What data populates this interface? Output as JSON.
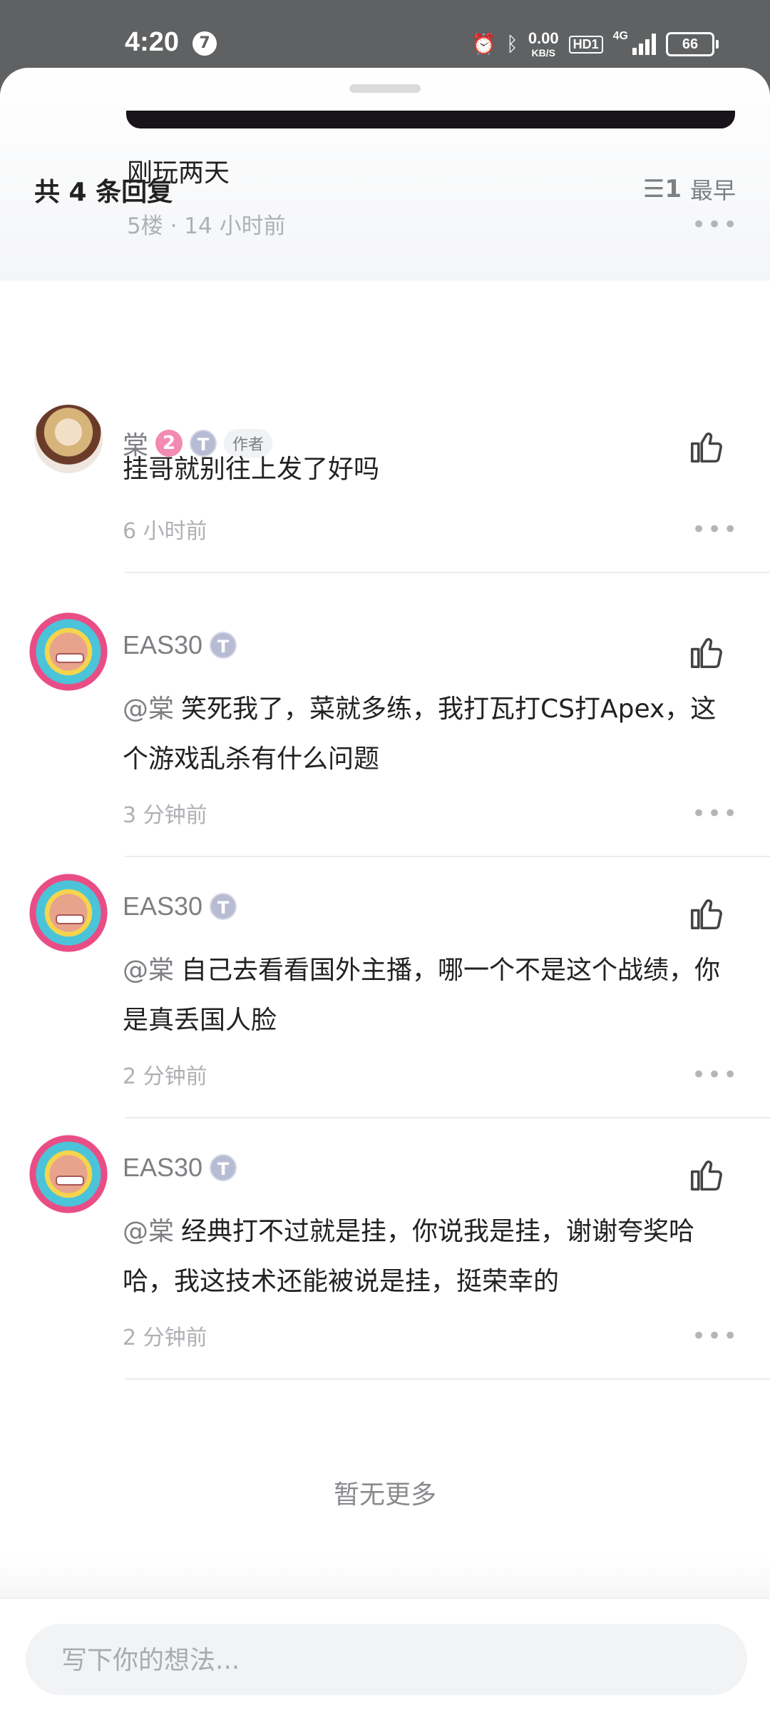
{
  "status_bar": {
    "time": "4:20",
    "app_icon": "7",
    "net_speed": "0.00",
    "net_unit": "KB/S",
    "hd": "HD1",
    "network": "4G",
    "battery": "66"
  },
  "parent": {
    "text": "刚玩两天",
    "meta": "5楼 · 14 小时前"
  },
  "replies_header": {
    "title": "共 4 条回复",
    "sort_label": "最早"
  },
  "comments": [
    {
      "name": "棠",
      "level": "2",
      "badge": "T",
      "tag": "作者",
      "text": "挂哥就别往上发了好吗",
      "time": "6 小时前"
    },
    {
      "name": "EAS30",
      "badge": "T",
      "mention": "@棠",
      "text": "笑死我了，菜就多练，我打瓦打CS打Apex，这个游戏乱杀有什么问题",
      "time": "3 分钟前"
    },
    {
      "name": "EAS30",
      "badge": "T",
      "mention": "@棠",
      "text": "自己去看看国外主播，哪一个不是这个战绩，你是真丢国人脸",
      "time": "2 分钟前"
    },
    {
      "name": "EAS30",
      "badge": "T",
      "mention": "@棠",
      "text": "经典打不过就是挂，你说我是挂，谢谢夸奖哈哈，我这技术还能被说是挂，挺荣幸的",
      "time": "2 分钟前"
    }
  ],
  "no_more": "暂无更多",
  "input": {
    "placeholder": "写下你的想法..."
  }
}
